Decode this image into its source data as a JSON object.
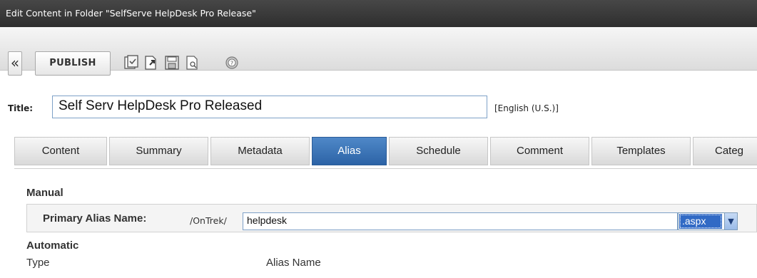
{
  "window": {
    "title": "Edit Content in Folder \"SelfServe HelpDesk Pro Release\""
  },
  "toolbar": {
    "back_icon": "«",
    "publish_label": "PUBLISH",
    "icons": [
      "checkin-icon",
      "submit-icon",
      "save-icon",
      "preview-icon",
      "help-icon"
    ]
  },
  "form": {
    "title_label": "Title:",
    "title_value": "Self Serv HelpDesk Pro Released",
    "language": "[English (U.S.)]"
  },
  "tabs": [
    {
      "label": "Content"
    },
    {
      "label": "Summary"
    },
    {
      "label": "Metadata"
    },
    {
      "label": "Alias",
      "active": true
    },
    {
      "label": "Schedule"
    },
    {
      "label": "Comment"
    },
    {
      "label": "Templates"
    },
    {
      "label": "Categ"
    }
  ],
  "alias": {
    "manual_heading": "Manual",
    "primary_label": "Primary Alias Name:",
    "prefix": "/OnTrek/",
    "value": "helpdesk",
    "extension": ".aspx",
    "automatic_heading": "Automatic",
    "columns": [
      "Type",
      "Alias Name"
    ]
  },
  "colors": {
    "accent": "#2c63a6",
    "titlebar": "#3a3a3a"
  }
}
